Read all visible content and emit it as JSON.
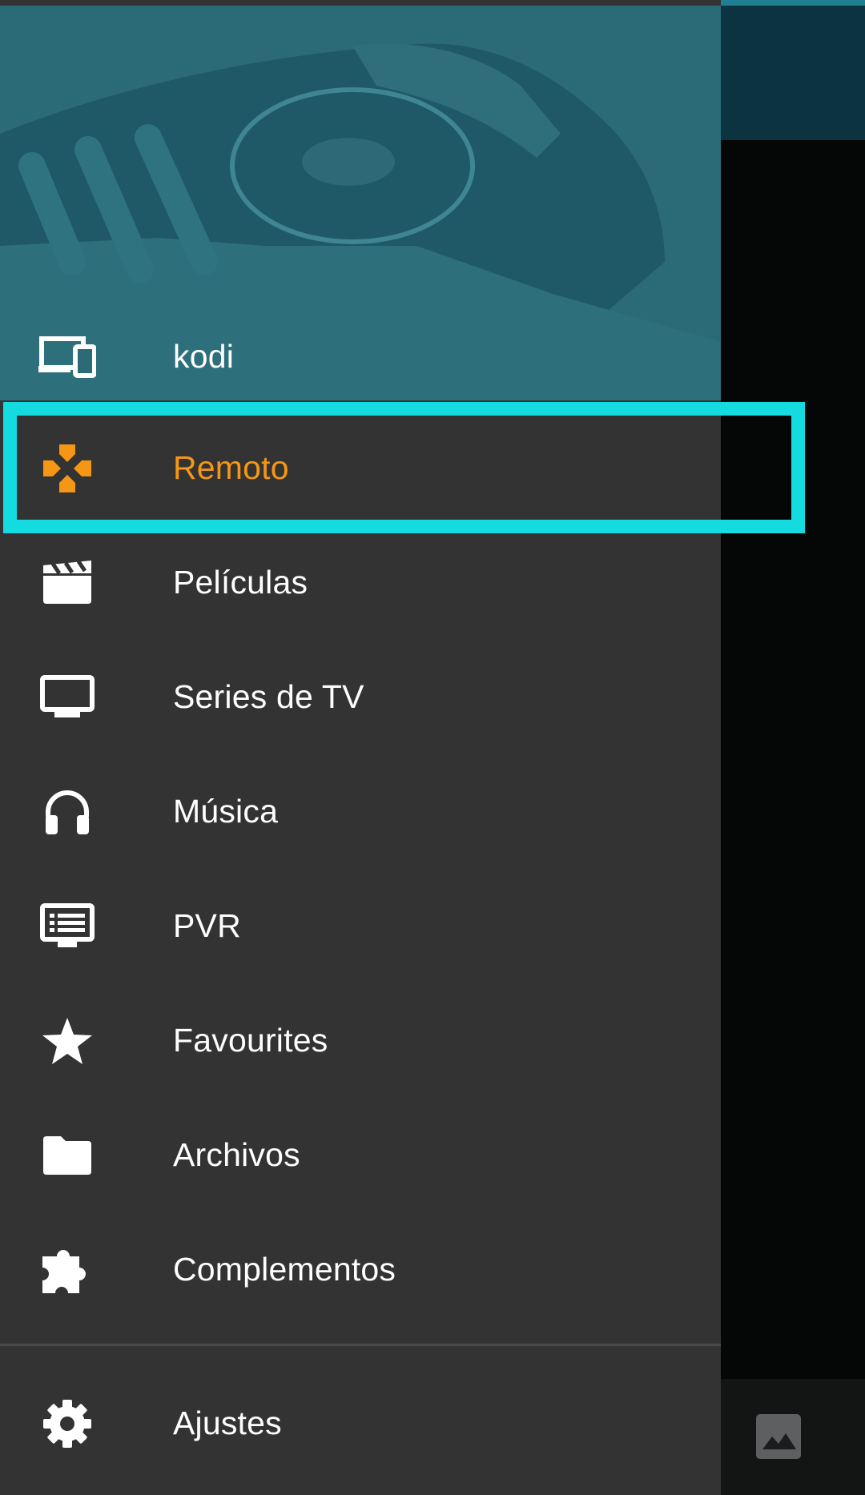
{
  "drawer": {
    "host": {
      "label": "kodi",
      "icon": "devices-icon"
    },
    "items": [
      {
        "label": "Remoto",
        "icon": "gamepad-icon",
        "active": true
      },
      {
        "label": "Películas",
        "icon": "clapperboard-icon"
      },
      {
        "label": "Series de TV",
        "icon": "tv-icon"
      },
      {
        "label": "Música",
        "icon": "headphones-icon"
      },
      {
        "label": "PVR",
        "icon": "pvr-icon"
      },
      {
        "label": "Favourites",
        "icon": "star-icon"
      },
      {
        "label": "Archivos",
        "icon": "folder-icon"
      },
      {
        "label": "Complementos",
        "icon": "puzzle-icon"
      }
    ],
    "settings": {
      "label": "Ajustes",
      "icon": "gear-icon"
    }
  },
  "background": {
    "icon": "image-icon"
  },
  "colors": {
    "accent_active": "#f59714",
    "highlight": "#14dbe0",
    "drawer_bg": "#333333",
    "header_bg": "#2b6b78"
  }
}
